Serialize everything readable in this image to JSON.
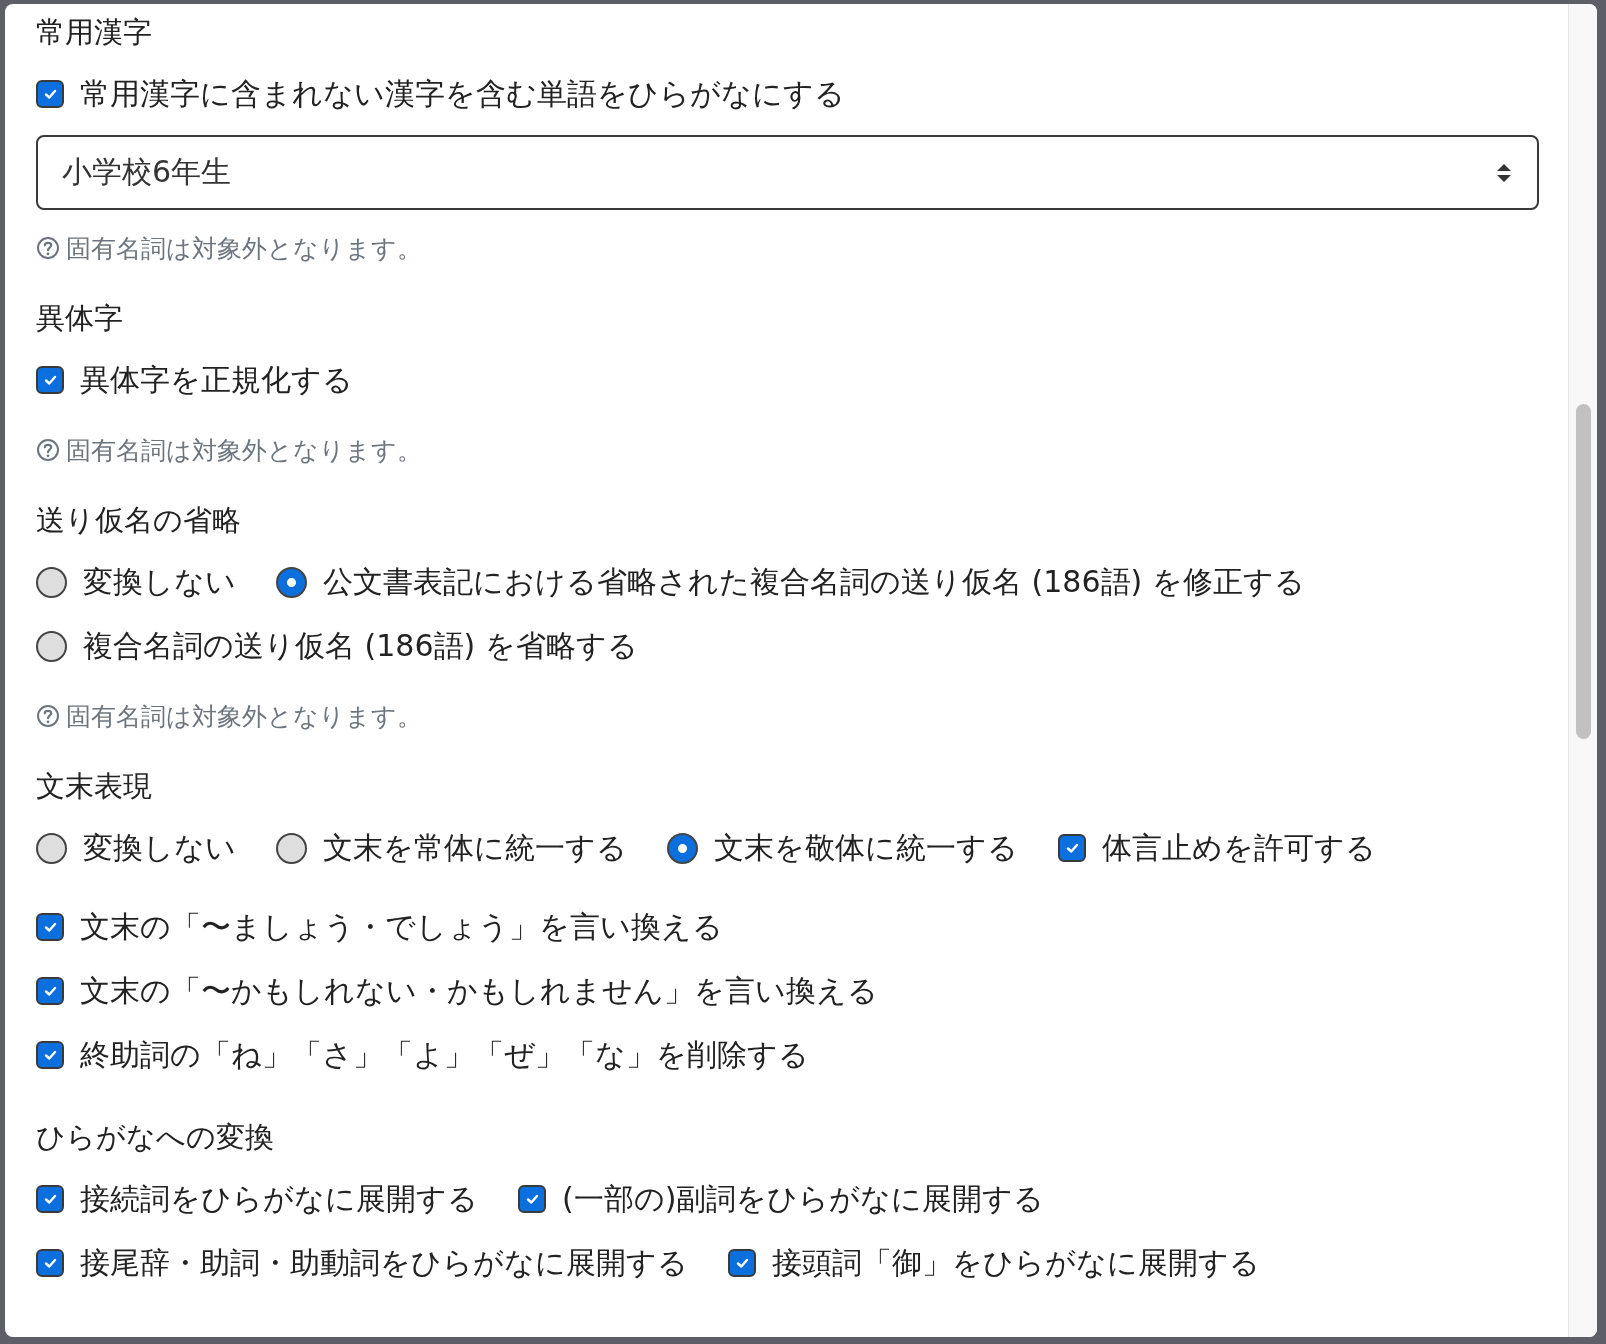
{
  "sections": [
    {
      "title": "常用漢字",
      "groups": [
        {
          "rows": [
            [
              {
                "kind": "checkbox",
                "label": "常用漢字に含まれない漢字を含む単語をひらがなにする",
                "checked": true
              }
            ]
          ]
        }
      ],
      "select": {
        "value": "小学校6年生"
      },
      "note": "固有名詞は対象外となります。"
    },
    {
      "title": "異体字",
      "groups": [
        {
          "rows": [
            [
              {
                "kind": "checkbox",
                "label": "異体字を正規化する",
                "checked": true
              }
            ]
          ]
        }
      ],
      "note": "固有名詞は対象外となります。"
    },
    {
      "title": "送り仮名の省略",
      "groups": [
        {
          "rows": [
            [
              {
                "kind": "radio",
                "label": "変換しない",
                "selected": false
              },
              {
                "kind": "radio",
                "label": "公文書表記における省略された複合名詞の送り仮名 (186語) を修正する",
                "selected": true
              }
            ],
            [
              {
                "kind": "radio",
                "label": "複合名詞の送り仮名 (186語) を省略する",
                "selected": false
              }
            ]
          ]
        }
      ],
      "note": "固有名詞は対象外となります。"
    },
    {
      "title": "文末表現",
      "groups": [
        {
          "rows": [
            [
              {
                "kind": "radio",
                "label": "変換しない",
                "selected": false
              },
              {
                "kind": "radio",
                "label": "文末を常体に統一する",
                "selected": false
              },
              {
                "kind": "radio",
                "label": "文末を敬体に統一する",
                "selected": true
              },
              {
                "kind": "checkbox",
                "label": "体言止めを許可する",
                "checked": true
              }
            ]
          ]
        },
        {
          "rows": [
            [
              {
                "kind": "checkbox",
                "label": "文末の「〜ましょう・でしょう」を言い換える",
                "checked": true
              }
            ],
            [
              {
                "kind": "checkbox",
                "label": "文末の「〜かもしれない・かもしれません」を言い換える",
                "checked": true
              }
            ],
            [
              {
                "kind": "checkbox",
                "label": "終助詞の「ね」「さ」「よ」「ぜ」「な」を削除する",
                "checked": true
              }
            ]
          ]
        }
      ]
    },
    {
      "title": "ひらがなへの変換",
      "groups": [
        {
          "rows": [
            [
              {
                "kind": "checkbox",
                "label": "接続詞をひらがなに展開する",
                "checked": true
              },
              {
                "kind": "checkbox",
                "label": "(一部の)副詞をひらがなに展開する",
                "checked": true
              }
            ],
            [
              {
                "kind": "checkbox",
                "label": "接尾辞・助詞・助動詞をひらがなに展開する",
                "checked": true
              },
              {
                "kind": "checkbox",
                "label": "接頭詞「御」をひらがなに展開する",
                "checked": true
              }
            ]
          ]
        }
      ]
    }
  ]
}
